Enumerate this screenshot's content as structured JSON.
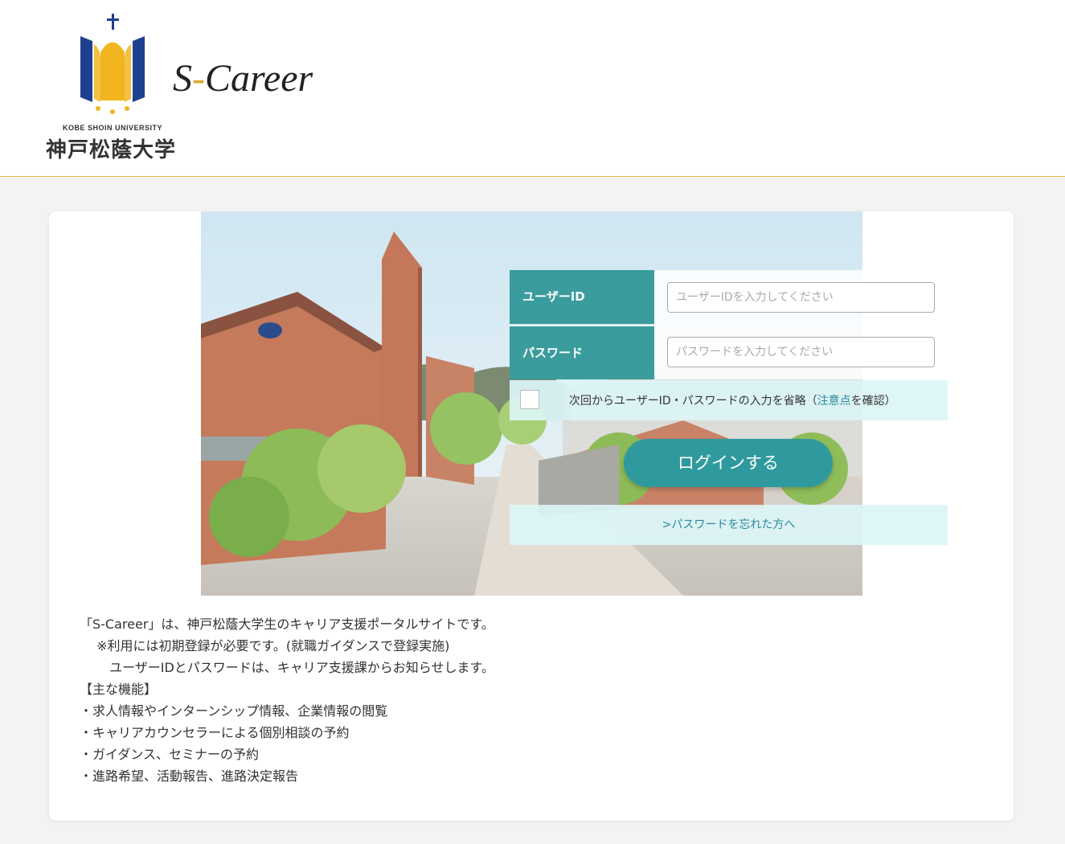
{
  "header": {
    "university_en": "KOBE SHOIN UNIVERSITY",
    "university_ja": "神戸松蔭大学",
    "brand_prefix": "S",
    "brand_dash": "-",
    "brand_suffix": "Career"
  },
  "login": {
    "user_id_label": "ユーザーID",
    "user_id_placeholder": "ユーザーIDを入力してください",
    "password_label": "パスワード",
    "password_placeholder": "パスワードを入力してください",
    "remember_prefix": "次回からユーザーID・パスワードの入力を省略（",
    "remember_link": "注意点",
    "remember_suffix": "を確認）",
    "login_button": "ログインする",
    "forgot_link": ">パスワードを忘れた方へ"
  },
  "description": {
    "lines": [
      "「S-Career」は、神戸松蔭大学生のキャリア支援ポータルサイトです。",
      "　 ※利用には初期登録が必要です。(就職ガイダンスで登録実施)",
      "　　 ユーザーIDとパスワードは、キャリア支援課からお知らせします。",
      "",
      "【主な機能】",
      "・求人情報やインターンシップ情報、企業情報の閲覧",
      "・キャリアカウンセラーによる個別相談の予約",
      "・ガイダンス、セミナーの予約",
      "・進路希望、活動報告、進路決定報告"
    ]
  },
  "colors": {
    "teal": "#3a9c9c",
    "gold": "#e8b84a",
    "navy": "#1f3f8f"
  }
}
